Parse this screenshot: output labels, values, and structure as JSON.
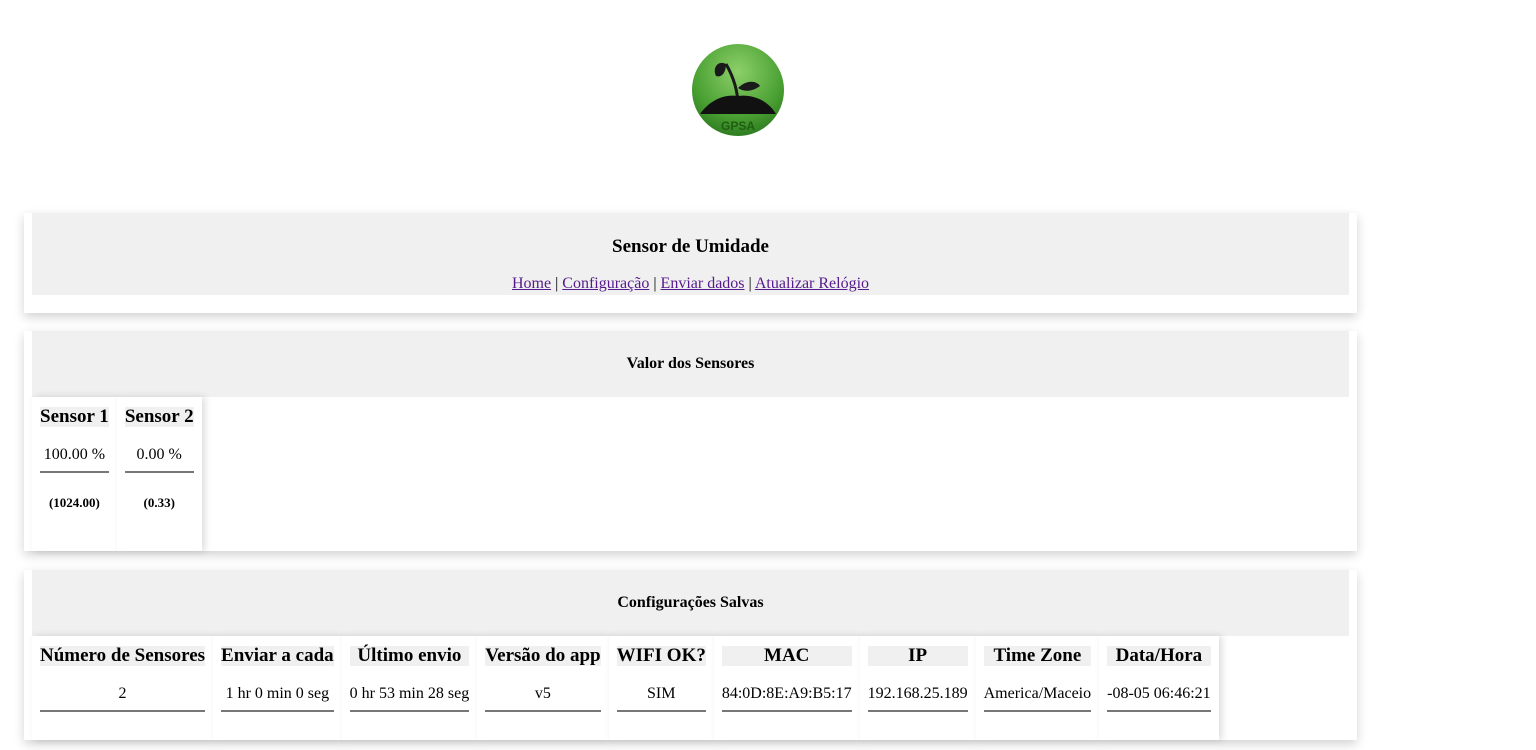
{
  "logo": {
    "text": "GPSA"
  },
  "header": {
    "title": "Sensor de Umidade",
    "nav": [
      "Home",
      "Configuração",
      "Enviar dados",
      "Atualizar Relógio"
    ],
    "separator": "|"
  },
  "sensors": {
    "title": "Valor dos Sensores",
    "items": [
      {
        "label": "Sensor 1",
        "value": "100.00 %",
        "raw": "(1024.00)"
      },
      {
        "label": "Sensor 2",
        "value": "0.00 %",
        "raw": "(0.33)"
      }
    ]
  },
  "config": {
    "title": "Configurações Salvas",
    "columns": [
      {
        "label": "Número de Sensores",
        "value": "2"
      },
      {
        "label": "Enviar a cada",
        "value": "1 hr 0 min 0 seg"
      },
      {
        "label": "Último envio",
        "value": "0 hr 53 min 28 seg"
      },
      {
        "label": "Versão do app",
        "value": "v5"
      },
      {
        "label": "WIFI OK?",
        "value": "SIM"
      },
      {
        "label": "MAC",
        "value": "84:0D:8E:A9:B5:17"
      },
      {
        "label": "IP",
        "value": "192.168.25.189"
      },
      {
        "label": "Time Zone",
        "value": "America/Maceio"
      },
      {
        "label": "Data/Hora",
        "value": "-08-05 06:46:21"
      }
    ]
  },
  "colors": {
    "header_bg": "#f0f0f0",
    "link": "#551a8b",
    "logo_green": "#4aa032"
  }
}
